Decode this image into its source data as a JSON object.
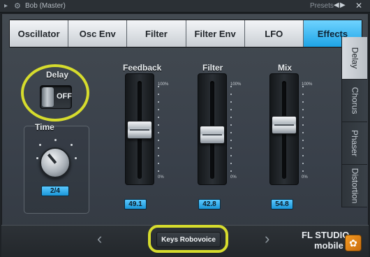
{
  "titlebar": {
    "title": "Bob (Master)",
    "presets_label": "Presets",
    "prev_glyph": "◀",
    "next_glyph": "▶",
    "close_glyph": "✕",
    "arrow_glyph": "▸",
    "gear_glyph": "⚙"
  },
  "tabs": [
    "Oscillator",
    "Osc Env",
    "Filter",
    "Filter Env",
    "LFO",
    "Effects"
  ],
  "active_tab": "Effects",
  "side_tabs": [
    "Delay",
    "Chorus",
    "Phaser",
    "Distortion"
  ],
  "active_side_tab": "Delay",
  "delay": {
    "label": "Delay",
    "toggle_state": "OFF"
  },
  "time": {
    "label": "Time",
    "value": "2/4"
  },
  "faders": {
    "feedback": {
      "label": "Feedback",
      "value": "49.1",
      "level": 0.491
    },
    "filter": {
      "label": "Filter",
      "value": "42.8",
      "level": 0.428
    },
    "mix": {
      "label": "Mix",
      "value": "54.8",
      "level": 0.548
    },
    "scale_top": "100%",
    "scale_bottom": "0%"
  },
  "bottom": {
    "preset_name": "Keys Robovoice",
    "prev_glyph": "‹",
    "next_glyph": "›",
    "logo_line1": "FL STUDIO",
    "logo_line2": "mobile"
  },
  "colors": {
    "accent": "#1ea4e6",
    "highlight": "#d6dc2d"
  }
}
